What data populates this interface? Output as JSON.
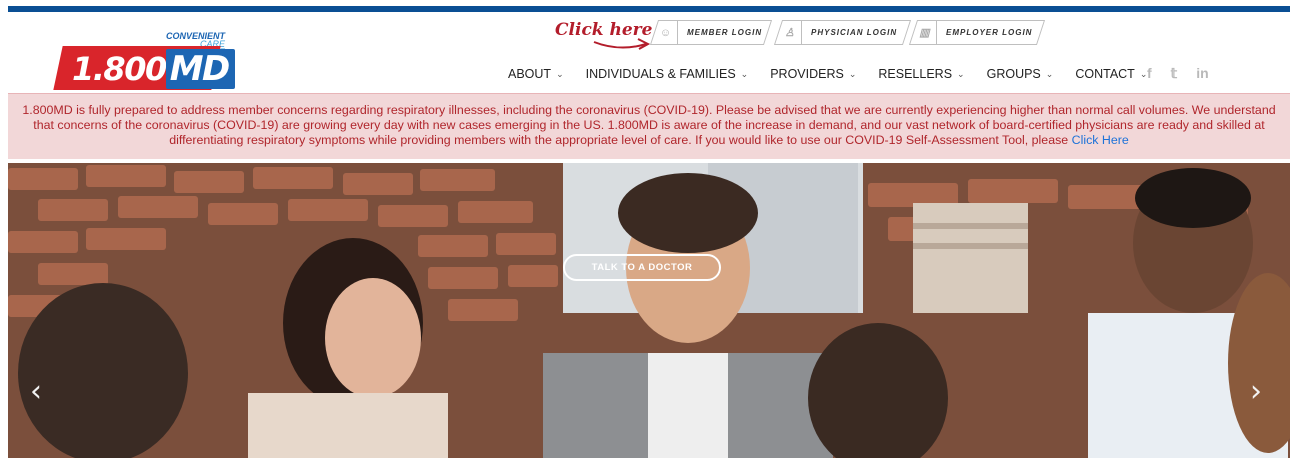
{
  "logo": {
    "tagline_1": "CONVENIENT",
    "tagline_2": "CARE ANYWHERE",
    "brand_number": "1.800",
    "brand_md": "MD"
  },
  "annotation": {
    "text": "Click here"
  },
  "logins": [
    {
      "label": "MEMBER LOGIN",
      "icon": "member-icon"
    },
    {
      "label": "PHYSICIAN LOGIN",
      "icon": "physician-icon"
    },
    {
      "label": "EMPLOYER LOGIN",
      "icon": "building-icon"
    }
  ],
  "nav": [
    {
      "label": "ABOUT"
    },
    {
      "label": "INDIVIDUALS & FAMILIES"
    },
    {
      "label": "PROVIDERS"
    },
    {
      "label": "RESELLERS"
    },
    {
      "label": "GROUPS"
    },
    {
      "label": "CONTACT"
    }
  ],
  "social": {
    "facebook": "f",
    "twitter": "𝕥",
    "linkedin": "in"
  },
  "alert": {
    "text": "1.800MD is fully prepared to address member concerns regarding respiratory illnesses, including the coronavirus (COVID-19). Please be advised that we are currently experiencing higher than normal call volumes. We understand that concerns of the coronavirus (COVID-19) are growing every day with new cases emerging in the US. 1.800MD is aware of the increase in demand, and our vast network of board-certified physicians are ready and skilled at differentiating respiratory symptoms while providing members with the appropriate level of care. If you would like to use our COVID-19 Self-Assessment Tool, please",
    "link": "Click Here"
  },
  "hero": {
    "cta": "TALK TO A DOCTOR",
    "prev": "‹",
    "next": "›"
  },
  "colors": {
    "brand_red": "#d9252b",
    "brand_blue": "#1d66b3",
    "alert_bg": "#f2d7d8",
    "alert_text": "#b0262c",
    "link": "#1d72d8"
  }
}
